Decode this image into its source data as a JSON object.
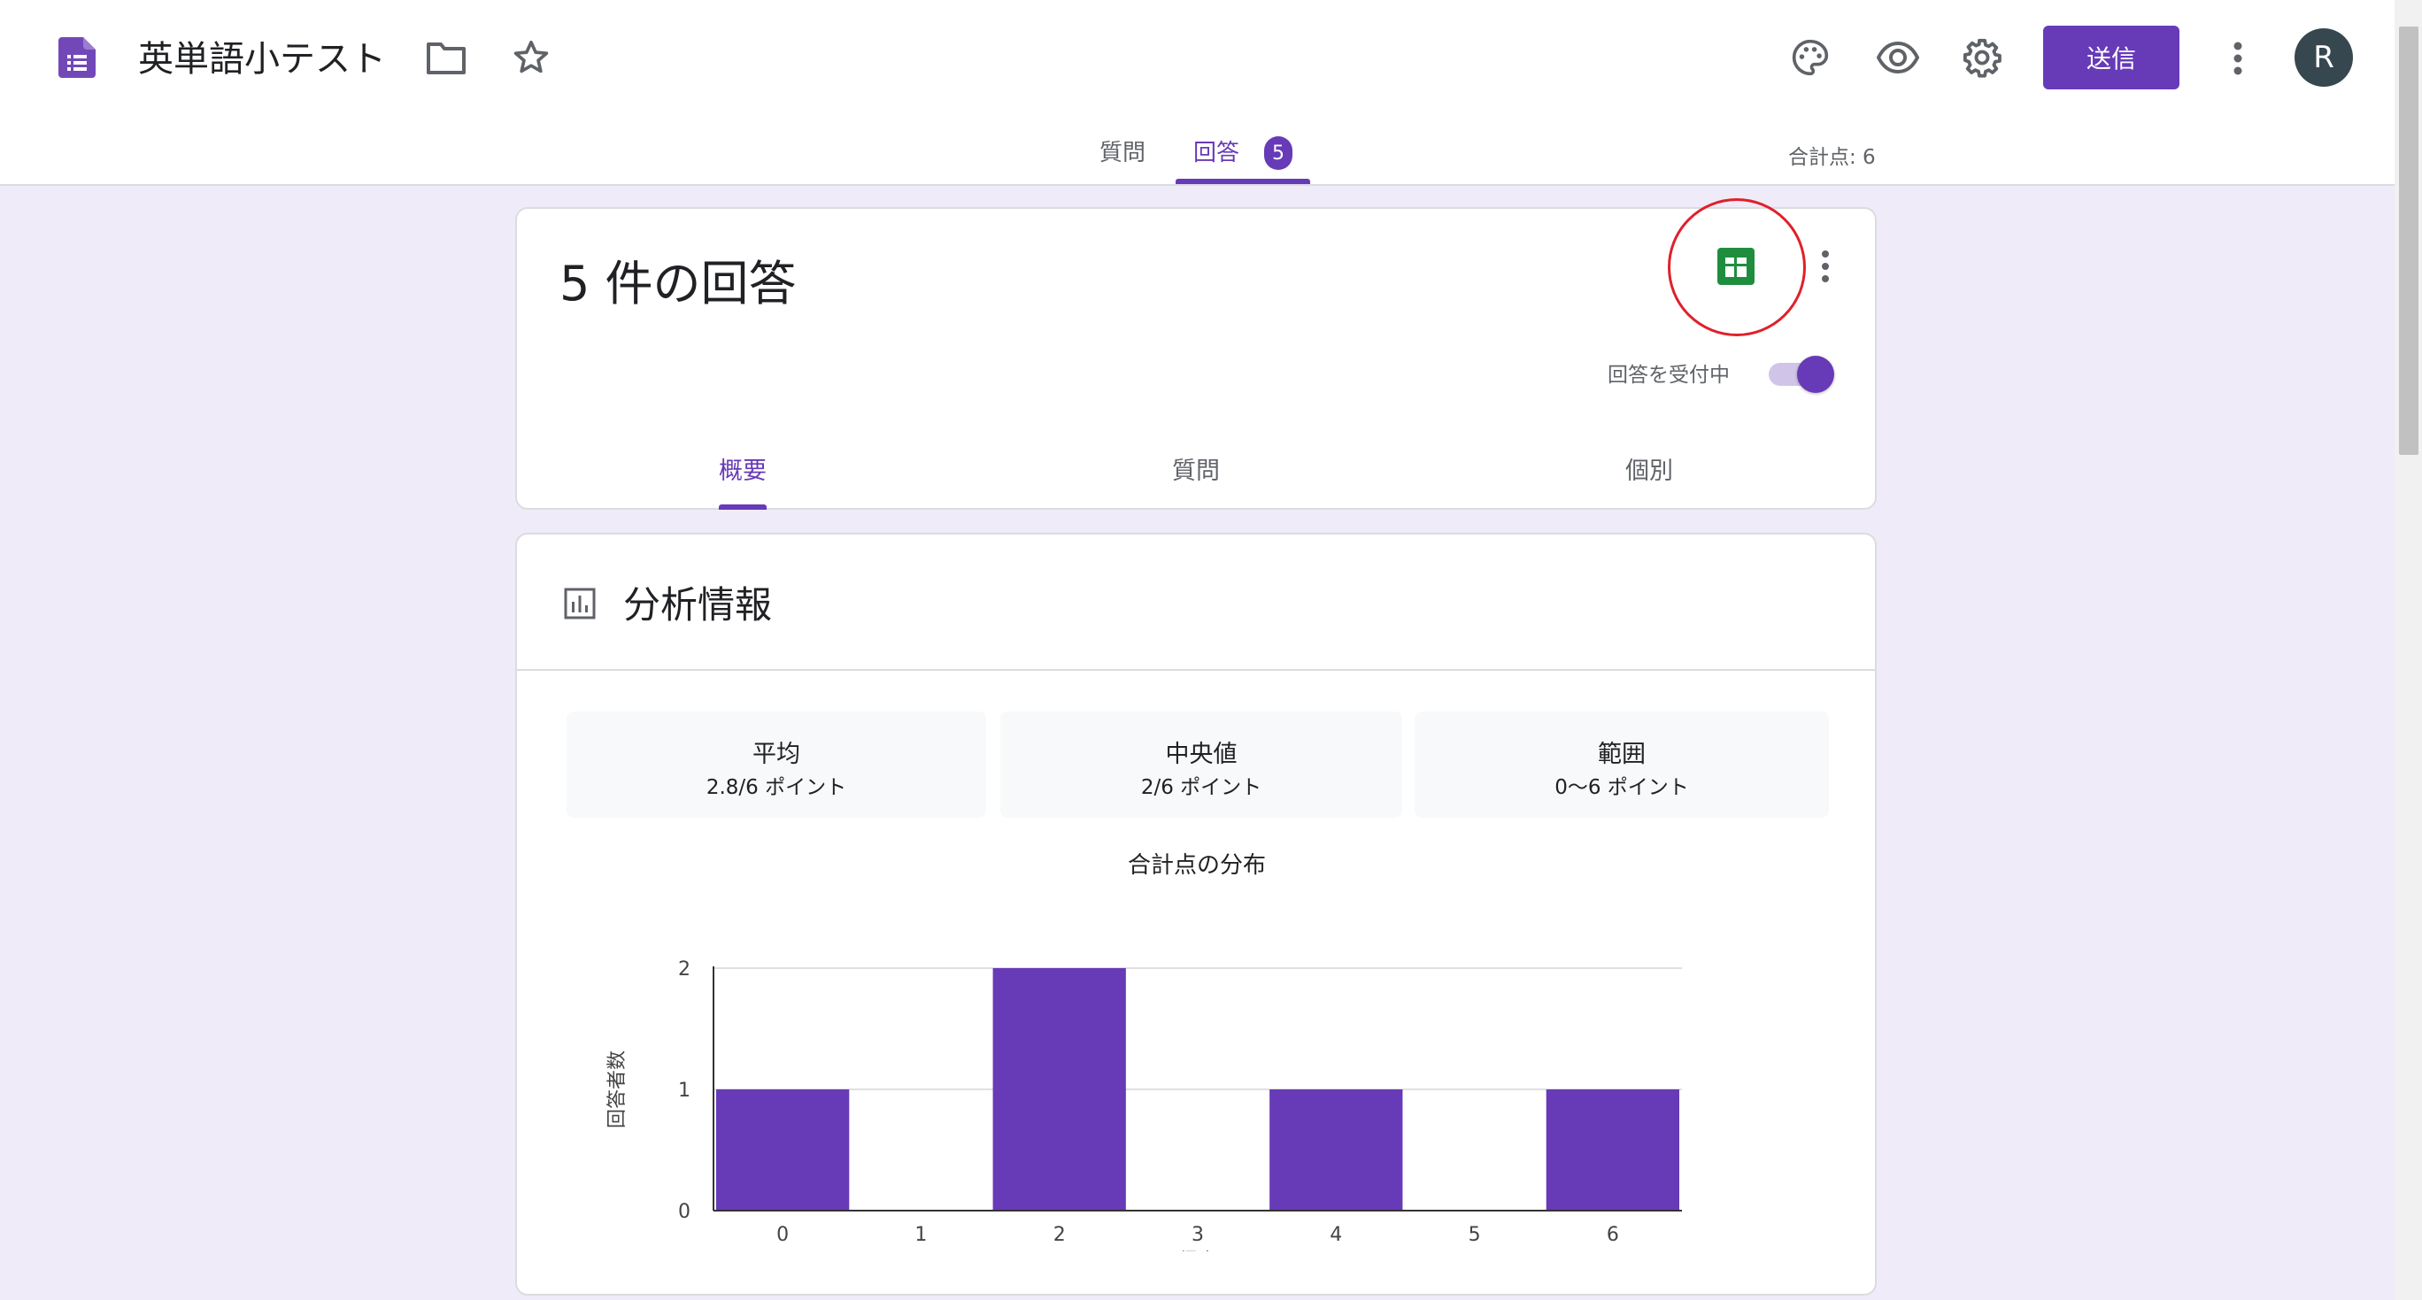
{
  "header": {
    "title": "英単語小テスト",
    "send_label": "送信",
    "avatar_initial": "R",
    "tabs": {
      "questions": "質問",
      "responses": "回答",
      "responses_count": "5"
    },
    "total_points": "合計点: 6"
  },
  "responses_card": {
    "heading": "5 件の回答",
    "accepting_label": "回答を受付中",
    "accepting": true,
    "sub_tabs": {
      "summary": "概要",
      "question": "質問",
      "individual": "個別"
    },
    "active_sub_tab": "概要"
  },
  "analytics": {
    "title": "分析情報",
    "stats": {
      "mean": {
        "label": "平均",
        "value": "2.8/6 ポイント"
      },
      "median": {
        "label": "中央値",
        "value": "2/6 ポイント"
      },
      "range": {
        "label": "範囲",
        "value": "0〜6 ポイント"
      }
    }
  },
  "colors": {
    "accent": "#673ab7",
    "sheets_green": "#1e8e3e",
    "annotation": "#e0202a"
  },
  "icons": [
    "forms-logo-icon",
    "folder-icon",
    "star-icon",
    "palette-icon",
    "eye-icon",
    "gear-icon",
    "more-vert-icon",
    "sheets-icon",
    "bar-chart-icon"
  ],
  "chart_data": {
    "type": "bar",
    "title": "合計点の分布",
    "xlabel": "得点",
    "ylabel": "回答者数",
    "categories": [
      "0",
      "1",
      "2",
      "3",
      "4",
      "5",
      "6"
    ],
    "values": [
      1,
      0,
      2,
      0,
      1,
      0,
      1
    ],
    "ylim": [
      0,
      2
    ],
    "yticks": [
      0,
      1,
      2
    ],
    "grid": true,
    "bar_color": "#673ab7"
  }
}
